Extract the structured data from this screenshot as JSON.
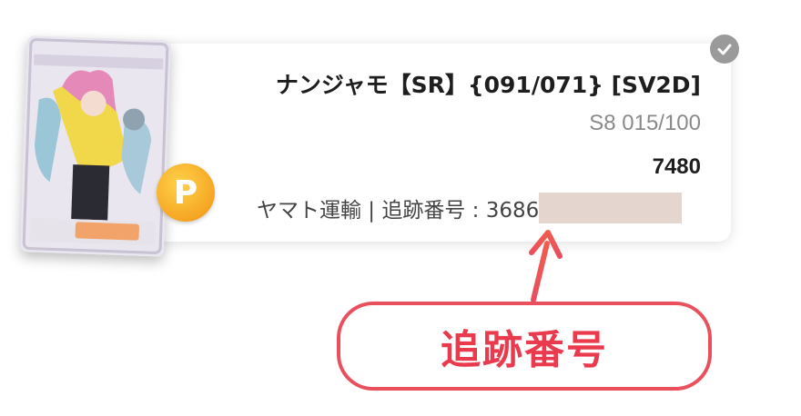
{
  "order": {
    "title": "ナンジャモ【SR】{091/071} [SV2D]",
    "subtitle": "S8 015/100",
    "price": "7480",
    "tracking_label": "ヤマト運輸 | 追跡番号 : 3686",
    "status_icon": "check-icon",
    "points_badge": "P"
  },
  "annotation": {
    "label": "追跡番号"
  },
  "colors": {
    "annotation_red": "#ea3b4e",
    "coin_orange": "#f5a623",
    "check_gray": "#9a9a9a",
    "redaction": "#e4d6cf"
  }
}
